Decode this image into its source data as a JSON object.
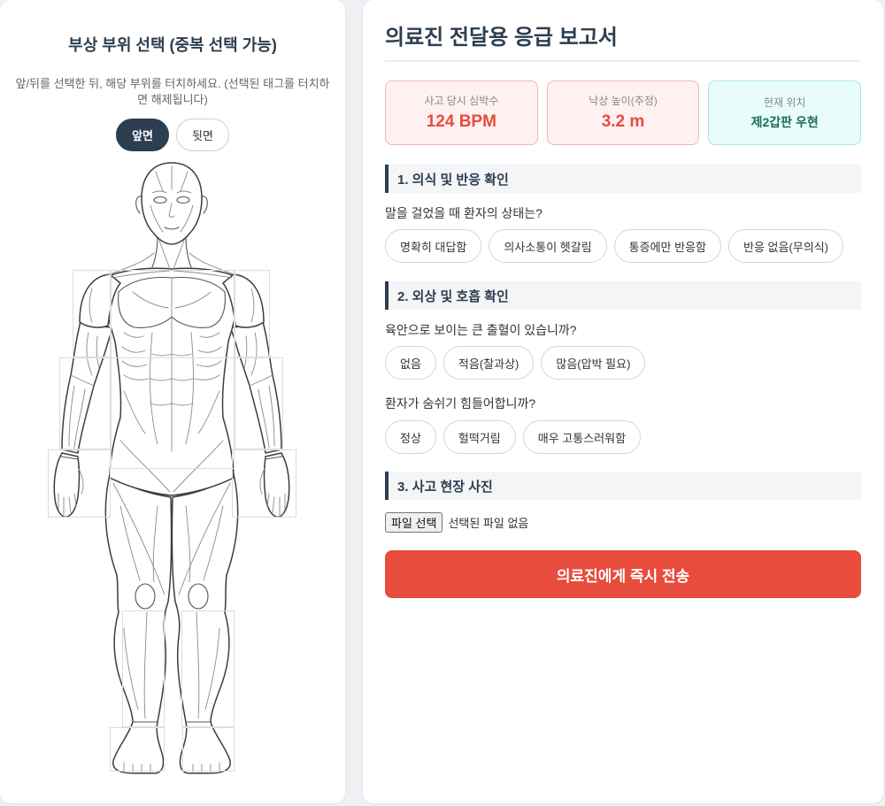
{
  "colors": {
    "accent": "#e74c3c",
    "navy": "#2c3e50",
    "teal": "#1b6e62",
    "alert_bg": "#fff1f1",
    "alert_border": "#f3b5b5",
    "info_bg": "#e8fdf9",
    "info_border": "#a5eadc"
  },
  "body_selector": {
    "title": "부상 부위 선택 (중복 선택 가능)",
    "instructions": "앞/뒤를 선택한 뒤, 해당 부위를 터치하세요. (선택된 태그를 터치하면 해제됩니다)",
    "views": [
      {
        "label": "앞면",
        "selected": true
      },
      {
        "label": "뒷면",
        "selected": false
      }
    ]
  },
  "report": {
    "title": "의료진 전달용 응급 보고서",
    "stats": [
      {
        "label": "사고 당시 심박수",
        "value": "124 BPM"
      },
      {
        "label": "낙상 높이(추정)",
        "value": "3.2 m"
      },
      {
        "label": "현재 위치",
        "value": "제2갑판 우현"
      }
    ],
    "sections": [
      {
        "heading": "1. 의식 및 반응 확인",
        "questions": [
          {
            "text": "말을 걸었을 때 환자의 상태는?",
            "options": [
              "명확히 대답함",
              "의사소통이 헷갈림",
              "통증에만 반응함",
              "반응 없음(무의식)"
            ]
          }
        ]
      },
      {
        "heading": "2. 외상 및 호흡 확인",
        "questions": [
          {
            "text": "육안으로 보이는 큰 출혈이 있습니까?",
            "options": [
              "없음",
              "적음(찰과상)",
              "많음(압박 필요)"
            ]
          },
          {
            "text": "환자가 숨쉬기 힘들어합니까?",
            "options": [
              "정상",
              "헐떡거림",
              "매우 고통스러워함"
            ]
          }
        ]
      }
    ],
    "photo": {
      "heading": "3. 사고 현장 사진",
      "file_button": "파일 선택",
      "file_status": "선택된 파일 없음"
    },
    "submit_label": "의료진에게 즉시 전송"
  }
}
